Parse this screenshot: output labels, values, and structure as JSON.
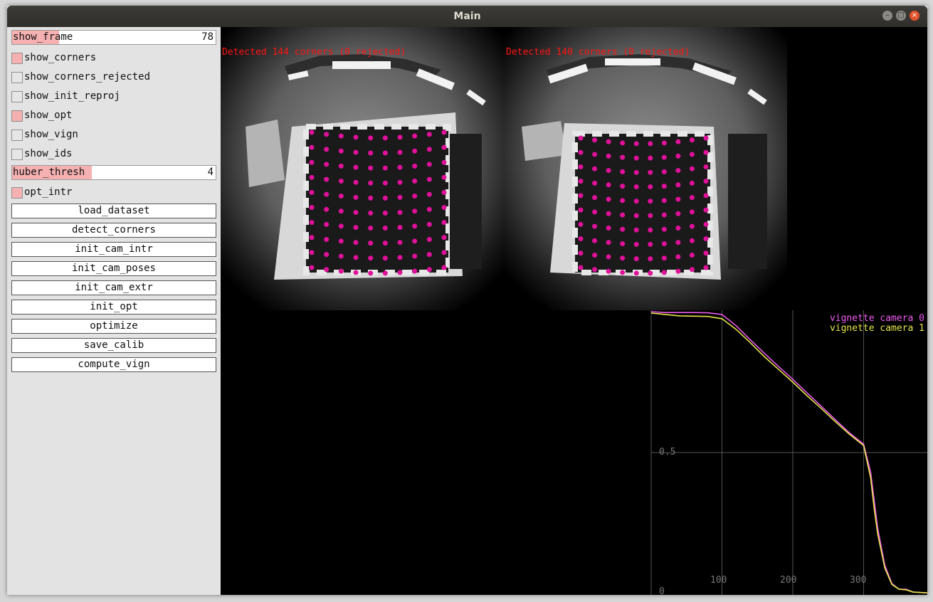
{
  "window": {
    "title": "Main"
  },
  "panel": {
    "show_frame": {
      "label": "show_frame",
      "value": "78",
      "level": 0.23
    },
    "checkboxes": [
      {
        "label": "show_corners",
        "checked": true
      },
      {
        "label": "show_corners_rejected",
        "checked": false
      },
      {
        "label": "show_init_reproj",
        "checked": false
      },
      {
        "label": "show_opt",
        "checked": true
      },
      {
        "label": "show_vign",
        "checked": false
      },
      {
        "label": "show_ids",
        "checked": false
      }
    ],
    "huber_thresh": {
      "label": "huber_thresh",
      "value": "4",
      "level": 0.39
    },
    "opt_intr": {
      "label": "opt_intr",
      "checked": true
    },
    "buttons": [
      "load_dataset",
      "detect_corners",
      "init_cam_intr",
      "init_cam_poses",
      "init_cam_extr",
      "init_opt",
      "optimize",
      "save_calib",
      "compute_vign"
    ]
  },
  "views": {
    "cam0": {
      "detected": "Detected 144 corners (0 rejected)"
    },
    "cam1": {
      "detected": "Detected 140 corners (0 rejected)"
    }
  },
  "plot": {
    "legend": [
      {
        "label": "vignette camera 0",
        "color": "#f05af0"
      },
      {
        "label": "vignette camera 1",
        "color": "#e6e64a"
      }
    ],
    "x_ticks": [
      "100",
      "200",
      "300"
    ],
    "y_ticks": [
      "0.5",
      "0"
    ],
    "chart_data": {
      "type": "line",
      "x": [
        0,
        20,
        40,
        60,
        80,
        100,
        120,
        140,
        160,
        180,
        200,
        220,
        240,
        260,
        280,
        300,
        310,
        315,
        320,
        330,
        340,
        350,
        360,
        370,
        390
      ],
      "series": [
        {
          "name": "vignette camera 0",
          "values": [
            1.0,
            0.997,
            0.997,
            0.997,
            0.996,
            0.99,
            0.95,
            0.9,
            0.852,
            0.805,
            0.76,
            0.712,
            0.665,
            0.617,
            0.57,
            0.53,
            0.43,
            0.33,
            0.23,
            0.1,
            0.035,
            0.015,
            0.015,
            0.005,
            0.002
          ]
        },
        {
          "name": "vignette camera 1",
          "values": [
            0.995,
            0.99,
            0.985,
            0.984,
            0.983,
            0.975,
            0.937,
            0.89,
            0.84,
            0.795,
            0.75,
            0.702,
            0.657,
            0.61,
            0.565,
            0.525,
            0.41,
            0.3,
            0.21,
            0.09,
            0.032,
            0.015,
            0.013,
            0.005,
            0.002
          ]
        }
      ],
      "xlim": [
        0,
        390
      ],
      "ylim": [
        0,
        1
      ]
    }
  }
}
